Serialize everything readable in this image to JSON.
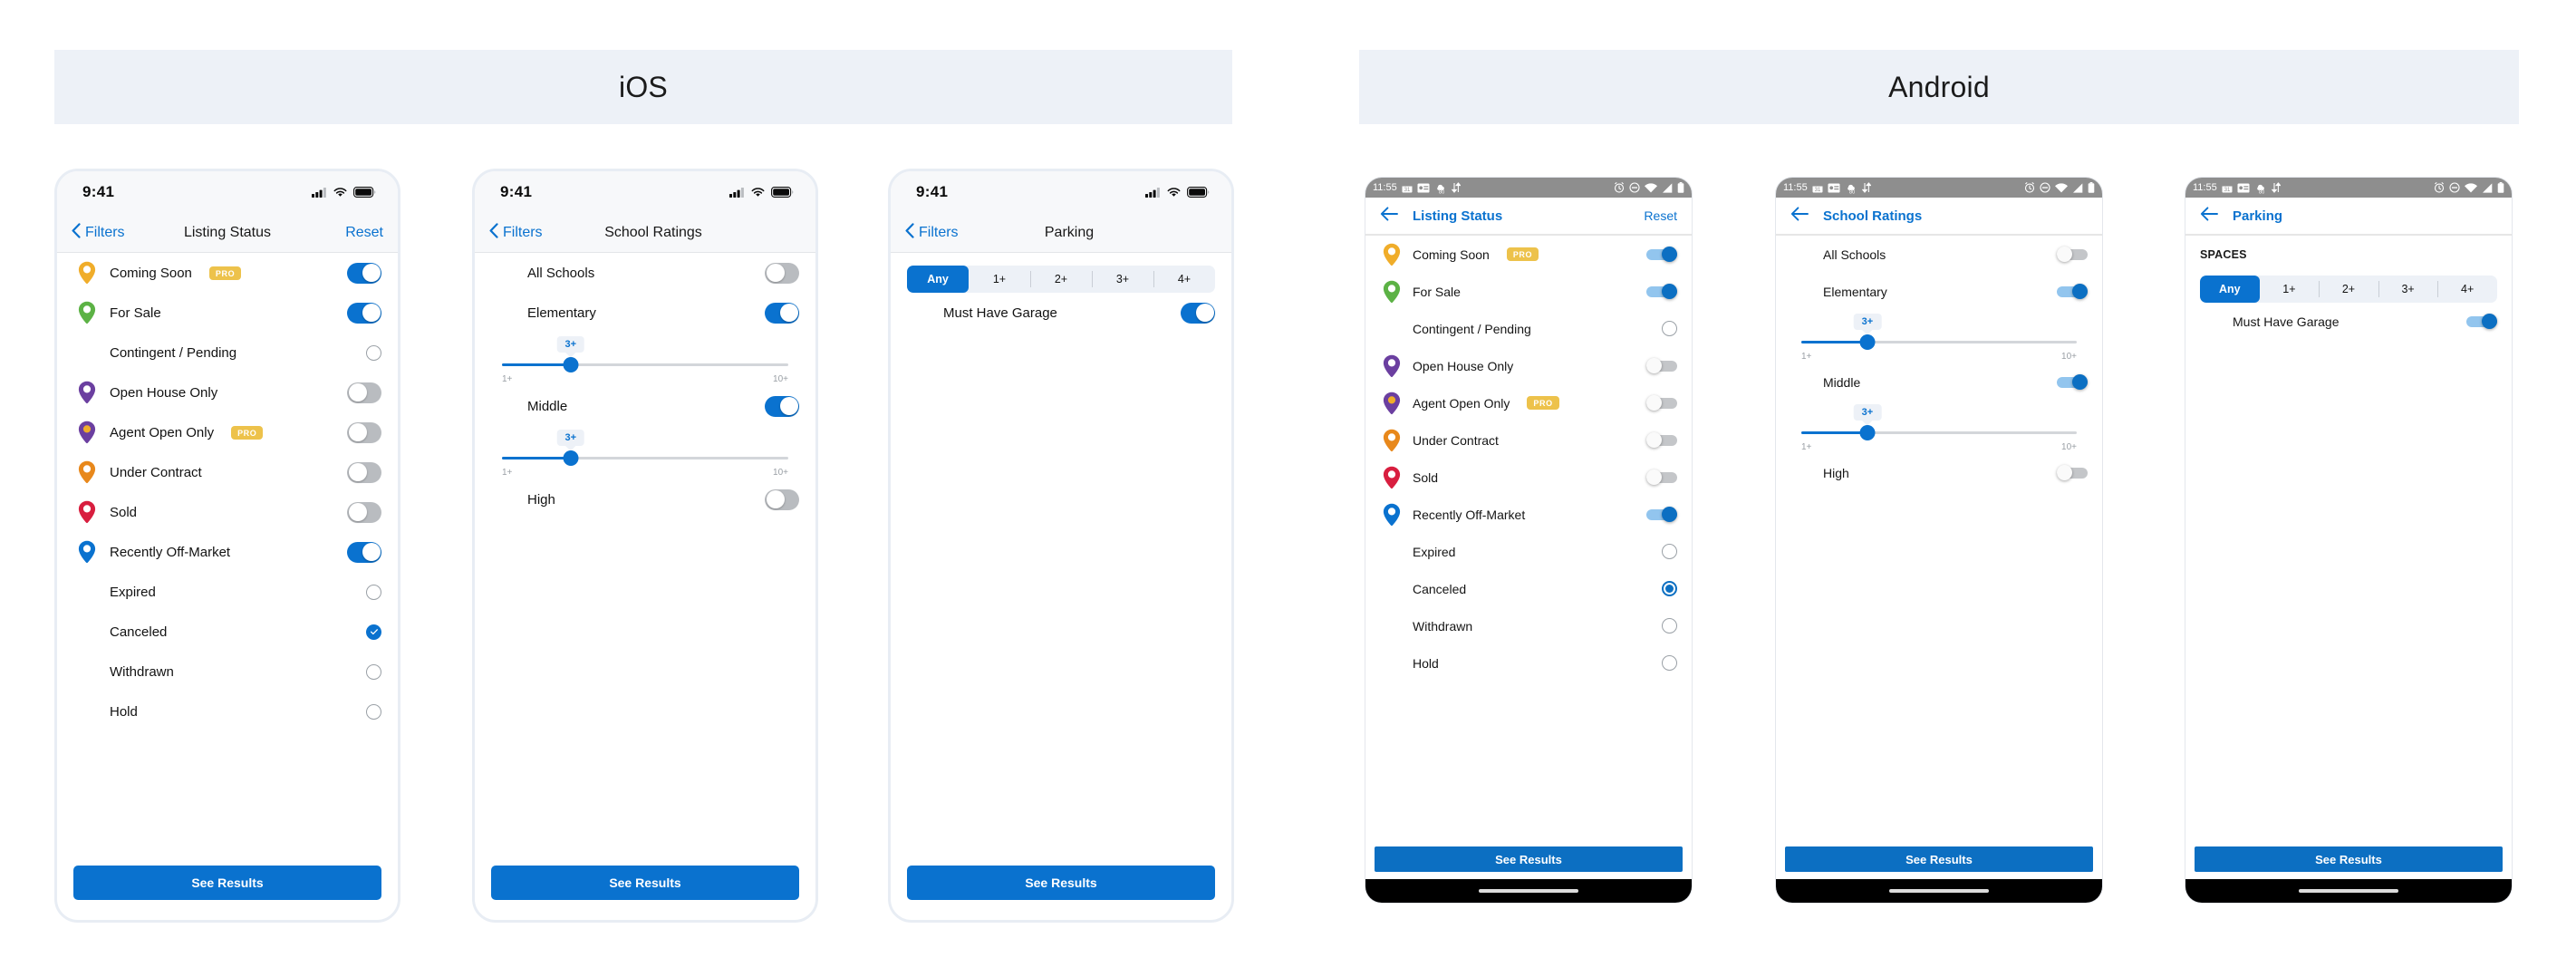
{
  "platforms": [
    {
      "id": "ios",
      "title": "iOS"
    },
    {
      "id": "android",
      "title": "Android"
    }
  ],
  "colors": {
    "accent_blue": "#0a72cf",
    "android_blue": "#0c6fc2",
    "pro_badge": "#edc24b",
    "header_bg": "#edf1f7",
    "pin_yellow": "#f0ad2a",
    "pin_green": "#5cb245",
    "pin_purple": "#6b3fa0",
    "pin_orange": "#e8881b",
    "pin_red": "#d81e3f",
    "pin_blue": "#0a72cf",
    "status_bar_gray": "#8e8e8e"
  },
  "ios": {
    "status": {
      "time": "9:41",
      "cellular": "signal-bars",
      "wifi": "wifi",
      "battery": "battery-full"
    },
    "back_label": "Filters",
    "reset_label": "Reset",
    "cta_label": "See Results",
    "screens": [
      {
        "title": "Listing Status",
        "has_reset": true,
        "rows": [
          {
            "pin": "pin_yellow",
            "pin_style": "hollow",
            "label": "Coming Soon",
            "badge": "PRO",
            "control": "toggle",
            "on": true
          },
          {
            "pin": "pin_green",
            "pin_style": "hollow",
            "label": "For Sale",
            "badge": "",
            "control": "toggle",
            "on": true
          },
          {
            "pin": "",
            "pin_style": "",
            "label": "Contingent / Pending",
            "badge": "",
            "control": "radio",
            "on": false
          },
          {
            "pin": "pin_purple",
            "pin_style": "hollow",
            "label": "Open House Only",
            "badge": "",
            "control": "toggle",
            "on": false
          },
          {
            "pin": "pin_purple",
            "pin_style": "dot-yellow",
            "label": "Agent Open Only",
            "badge": "PRO",
            "control": "toggle",
            "on": false
          },
          {
            "pin": "pin_orange",
            "pin_style": "hollow",
            "label": "Under Contract",
            "badge": "",
            "control": "toggle",
            "on": false
          },
          {
            "pin": "pin_red",
            "pin_style": "hollow",
            "label": "Sold",
            "badge": "",
            "control": "toggle",
            "on": false
          },
          {
            "pin": "pin_blue",
            "pin_style": "hollow",
            "label": "Recently Off-Market",
            "badge": "",
            "control": "toggle",
            "on": true
          },
          {
            "pin": "",
            "pin_style": "",
            "label": "Expired",
            "badge": "",
            "control": "radio",
            "on": false
          },
          {
            "pin": "",
            "pin_style": "",
            "label": "Canceled",
            "badge": "",
            "control": "check",
            "on": true
          },
          {
            "pin": "",
            "pin_style": "",
            "label": "Withdrawn",
            "badge": "",
            "control": "radio",
            "on": false
          },
          {
            "pin": "",
            "pin_style": "",
            "label": "Hold",
            "badge": "",
            "control": "radio",
            "on": false
          }
        ]
      },
      {
        "title": "School Ratings",
        "has_reset": false,
        "rows": [
          {
            "pin": "",
            "pin_style": "",
            "label": "All Schools",
            "badge": "",
            "control": "toggle",
            "on": false
          },
          {
            "pin": "",
            "pin_style": "",
            "label": "Elementary",
            "badge": "",
            "control": "toggle",
            "on": true
          },
          {
            "pin": "",
            "pin_style": "",
            "label": "Middle",
            "badge": "",
            "control": "toggle",
            "on": true
          },
          {
            "pin": "",
            "pin_style": "",
            "label": "High",
            "badge": "",
            "control": "toggle",
            "on": false
          }
        ],
        "sliders": [
          {
            "after_row": "Elementary",
            "value_label": "3+",
            "min_label": "1+",
            "max_label": "10+",
            "percent": 24
          },
          {
            "after_row": "Middle",
            "value_label": "3+",
            "min_label": "1+",
            "max_label": "10+",
            "percent": 24
          }
        ]
      },
      {
        "title": "Parking",
        "has_reset": false,
        "segmented": {
          "options": [
            "Any",
            "1+",
            "2+",
            "3+",
            "4+"
          ],
          "selected": "Any"
        },
        "rows": [
          {
            "pin": "",
            "pin_style": "",
            "label": "Must Have Garage",
            "badge": "",
            "control": "toggle",
            "on": true
          }
        ]
      }
    ]
  },
  "android": {
    "status": {
      "time": "11:55",
      "left_icons": [
        "calendar-icon",
        "contact-card-icon",
        "weather-80-icon",
        "sync-arrows-icon"
      ],
      "right_icons": [
        "alarm-icon",
        "do-not-disturb-icon",
        "wifi-icon",
        "signal-icon",
        "battery-icon"
      ]
    },
    "back_icon": "arrow-left-icon",
    "reset_label": "Reset",
    "cta_label": "See Results",
    "screens": [
      {
        "title": "Listing Status",
        "has_reset": true,
        "rows": [
          {
            "pin": "pin_yellow",
            "pin_style": "hollow",
            "label": "Coming Soon",
            "badge": "PRO",
            "control": "toggle",
            "on": true
          },
          {
            "pin": "pin_green",
            "pin_style": "hollow",
            "label": "For Sale",
            "badge": "",
            "control": "toggle",
            "on": true
          },
          {
            "pin": "",
            "pin_style": "",
            "label": "Contingent / Pending",
            "badge": "",
            "control": "radio",
            "on": false
          },
          {
            "pin": "pin_purple",
            "pin_style": "hollow",
            "label": "Open House Only",
            "badge": "",
            "control": "toggle",
            "on": false
          },
          {
            "pin": "pin_purple",
            "pin_style": "dot-yellow",
            "label": "Agent Open Only",
            "badge": "PRO",
            "control": "toggle",
            "on": false
          },
          {
            "pin": "pin_orange",
            "pin_style": "hollow",
            "label": "Under Contract",
            "badge": "",
            "control": "toggle",
            "on": false
          },
          {
            "pin": "pin_red",
            "pin_style": "hollow",
            "label": "Sold",
            "badge": "",
            "control": "toggle",
            "on": false
          },
          {
            "pin": "pin_blue",
            "pin_style": "hollow",
            "label": "Recently Off-Market",
            "badge": "",
            "control": "toggle",
            "on": true
          },
          {
            "pin": "",
            "pin_style": "",
            "label": "Expired",
            "badge": "",
            "control": "radio",
            "on": false
          },
          {
            "pin": "",
            "pin_style": "",
            "label": "Canceled",
            "badge": "",
            "control": "radio",
            "on": true
          },
          {
            "pin": "",
            "pin_style": "",
            "label": "Withdrawn",
            "badge": "",
            "control": "radio",
            "on": false
          },
          {
            "pin": "",
            "pin_style": "",
            "label": "Hold",
            "badge": "",
            "control": "radio",
            "on": false
          }
        ]
      },
      {
        "title": "School Ratings",
        "has_reset": false,
        "rows": [
          {
            "pin": "",
            "pin_style": "",
            "label": "All Schools",
            "badge": "",
            "control": "toggle",
            "on": false
          },
          {
            "pin": "",
            "pin_style": "",
            "label": "Elementary",
            "badge": "",
            "control": "toggle",
            "on": true
          },
          {
            "pin": "",
            "pin_style": "",
            "label": "Middle",
            "badge": "",
            "control": "toggle",
            "on": true
          },
          {
            "pin": "",
            "pin_style": "",
            "label": "High",
            "badge": "",
            "control": "toggle",
            "on": false
          }
        ],
        "sliders": [
          {
            "after_row": "Elementary",
            "value_label": "3+",
            "min_label": "1+",
            "max_label": "10+",
            "percent": 24
          },
          {
            "after_row": "Middle",
            "value_label": "3+",
            "min_label": "1+",
            "max_label": "10+",
            "percent": 24
          }
        ]
      },
      {
        "title": "Parking",
        "has_reset": false,
        "section_label": "SPACES",
        "segmented": {
          "options": [
            "Any",
            "1+",
            "2+",
            "3+",
            "4+"
          ],
          "selected": "Any"
        },
        "rows": [
          {
            "pin": "",
            "pin_style": "",
            "label": "Must Have Garage",
            "badge": "",
            "control": "toggle",
            "on": true
          }
        ]
      }
    ]
  }
}
